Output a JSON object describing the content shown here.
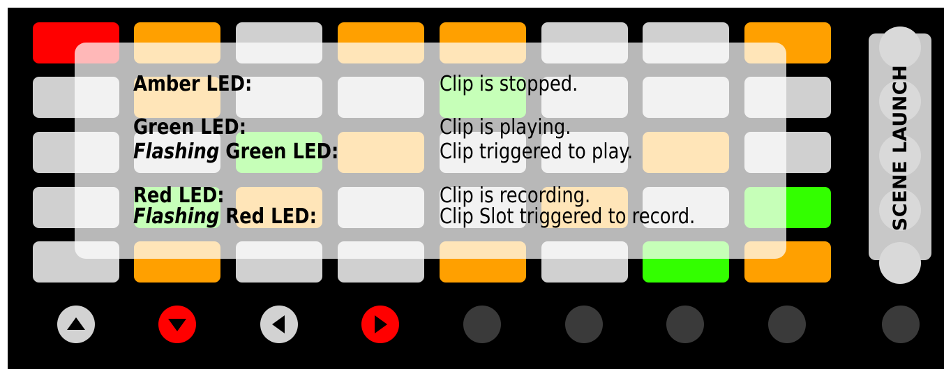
{
  "colors": {
    "red": "#ff0000",
    "amber": "#ffa000",
    "green": "#33ff00",
    "gray": "#d0d0d0",
    "dark": "#3a3a3a",
    "light": "#d2d2d2"
  },
  "grid": {
    "rows": [
      [
        "red",
        "amber",
        "gray",
        "amber",
        "amber",
        "gray",
        "gray",
        "amber"
      ],
      [
        "gray",
        "amber",
        "gray",
        "gray",
        "green",
        "gray",
        "gray",
        "gray"
      ],
      [
        "gray",
        "gray",
        "green",
        "amber",
        "gray",
        "gray",
        "amber",
        "gray"
      ],
      [
        "gray",
        "green",
        "amber",
        "gray",
        "gray",
        "amber",
        "gray",
        "green"
      ],
      [
        "gray",
        "amber",
        "gray",
        "gray",
        "amber",
        "gray",
        "green",
        "amber"
      ]
    ]
  },
  "scene_launch": {
    "label": "SCENE LAUNCH"
  },
  "controls": [
    {
      "icon": "up-arrow-icon",
      "color": "light"
    },
    {
      "icon": "down-arrow-icon",
      "color": "red"
    },
    {
      "icon": "left-arrow-icon",
      "color": "light"
    },
    {
      "icon": "right-arrow-icon",
      "color": "red"
    },
    {
      "icon": "round-button-icon",
      "color": "dark"
    },
    {
      "icon": "round-button-icon",
      "color": "dark"
    },
    {
      "icon": "round-button-icon",
      "color": "dark"
    },
    {
      "icon": "round-button-icon",
      "color": "dark"
    },
    {
      "icon": "round-button-icon",
      "color": "dark"
    }
  ],
  "legend": {
    "amber": {
      "label": "Amber LED:",
      "desc": "Clip is stopped."
    },
    "green": {
      "label": "Green LED:",
      "desc": "Clip is playing."
    },
    "flash_green": {
      "prefix": "Flashing",
      "label": " Green LED:",
      "desc": "Clip triggered to play."
    },
    "red": {
      "label": "Red LED:",
      "desc": "Clip is recording."
    },
    "flash_red": {
      "prefix": "Flashing",
      "label": " Red LED:",
      "desc": "Clip Slot triggered to record."
    }
  }
}
